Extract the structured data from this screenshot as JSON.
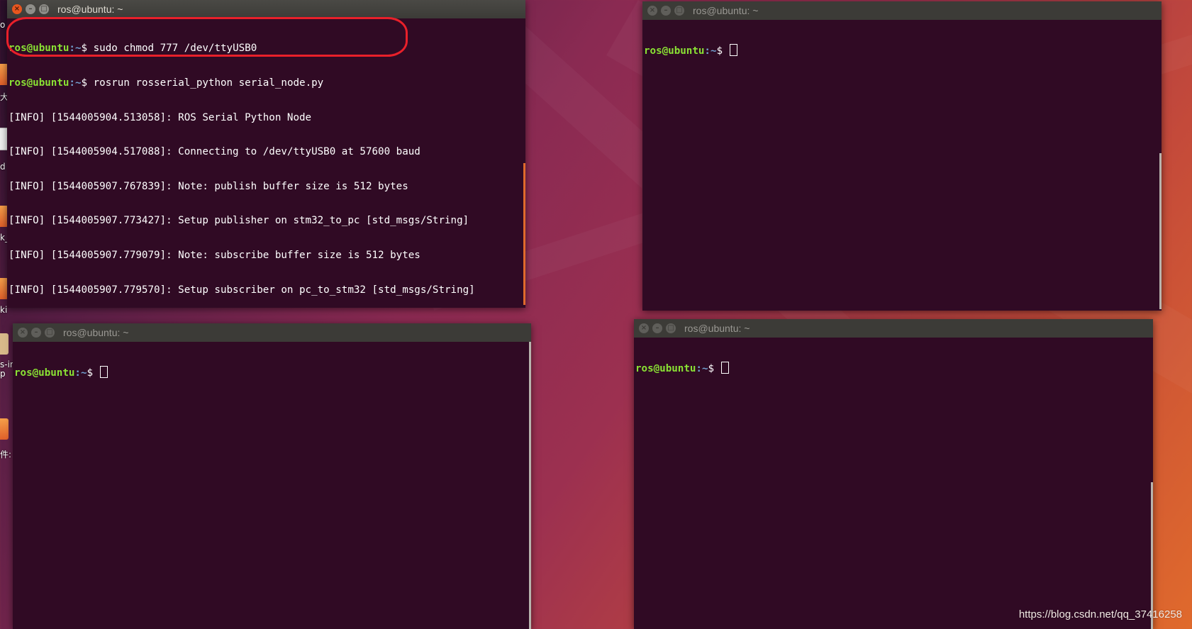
{
  "desktop": {
    "icon_labels": [
      "o",
      "大",
      "d",
      "k_",
      "ki",
      "s-in\np",
      "件:"
    ],
    "watermark": "https://blog.csdn.net/qq_37416258"
  },
  "terminals": [
    {
      "id": "top-left",
      "title": "ros@ubuntu: ~",
      "active": true,
      "lines": [
        {
          "user": "ros@ubuntu",
          "path": ":~",
          "sym": "$ ",
          "cmd": "sudo chmod 777 /dev/ttyUSB0"
        },
        {
          "user": "ros@ubuntu",
          "path": ":~",
          "sym": "$ ",
          "cmd": "rosrun rosserial_python serial_node.py"
        },
        {
          "text": "[INFO] [1544005904.513058]: ROS Serial Python Node"
        },
        {
          "text": "[INFO] [1544005904.517088]: Connecting to /dev/ttyUSB0 at 57600 baud"
        },
        {
          "text": "[INFO] [1544005907.767839]: Note: publish buffer size is 512 bytes"
        },
        {
          "text": "[INFO] [1544005907.773427]: Setup publisher on stm32_to_pc [std_msgs/String]"
        },
        {
          "text": "[INFO] [1544005907.779079]: Note: subscribe buffer size is 512 bytes"
        },
        {
          "text": "[INFO] [1544005907.779570]: Setup subscriber on pc_to_stm32 [std_msgs/String]"
        }
      ]
    },
    {
      "id": "top-right",
      "title": "ros@ubuntu: ~",
      "active": false,
      "lines": [
        {
          "user": "ros@ubuntu",
          "path": ":~",
          "sym": "$ ",
          "cmd": ""
        }
      ]
    },
    {
      "id": "bottom-left",
      "title": "ros@ubuntu: ~",
      "active": false,
      "lines": [
        {
          "user": "ros@ubuntu",
          "path": ":~",
          "sym": "$ ",
          "cmd": ""
        }
      ]
    },
    {
      "id": "bottom-right",
      "title": "ros@ubuntu: ~",
      "active": false,
      "lines": [
        {
          "user": "ros@ubuntu",
          "path": ":~",
          "sym": "$ ",
          "cmd": ""
        }
      ]
    }
  ],
  "window_buttons": {
    "close": "×",
    "minimize": "–",
    "maximize": "□"
  },
  "colors": {
    "terminal_bg": "#300a24",
    "prompt_user": "#8ae234",
    "prompt_path": "#729fcf",
    "annotation": "#e8202a"
  }
}
